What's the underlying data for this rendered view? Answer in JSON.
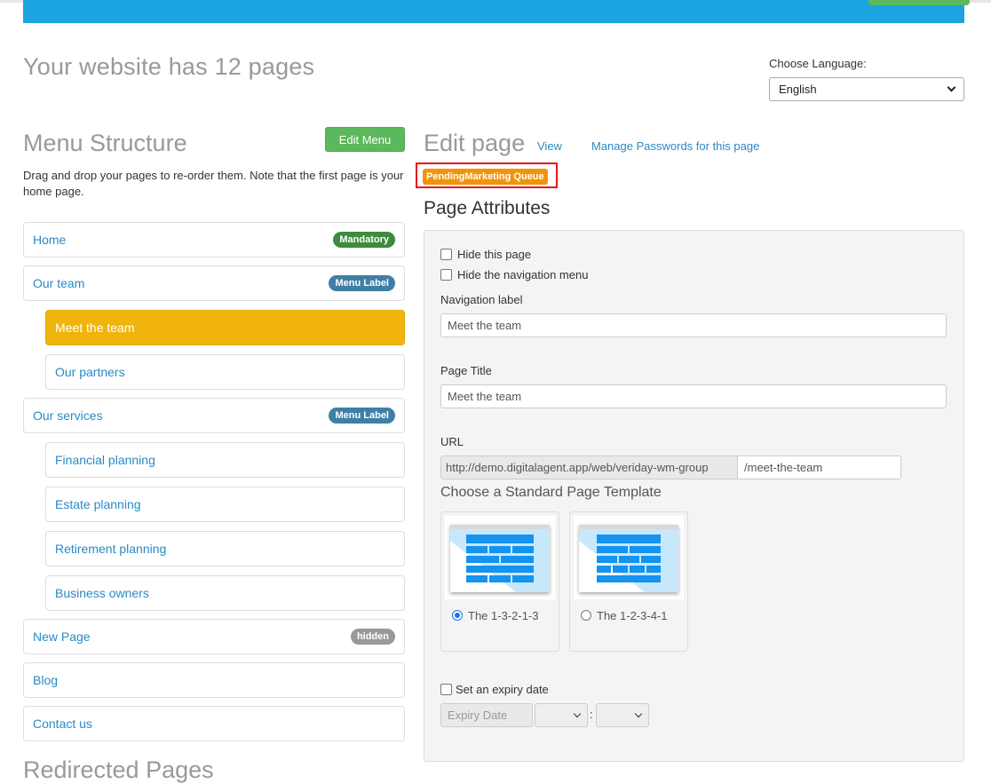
{
  "header": {
    "site_title": "Your website has 12 pages",
    "language_label": "Choose Language:",
    "language_value": "English"
  },
  "menu": {
    "title": "Menu Structure",
    "edit_button": "Edit Menu",
    "description": "Drag and drop your pages to re-order them. Note that the first page is your home page.",
    "items": [
      {
        "label": "Home",
        "badge": "Mandatory"
      },
      {
        "label": "Our team",
        "badge": "Menu Label"
      },
      {
        "label": "Meet the team",
        "badge": ""
      },
      {
        "label": "Our partners",
        "badge": ""
      },
      {
        "label": "Our services",
        "badge": "Menu Label"
      },
      {
        "label": "Financial planning",
        "badge": ""
      },
      {
        "label": "Estate planning",
        "badge": ""
      },
      {
        "label": "Retirement planning",
        "badge": ""
      },
      {
        "label": "Business owners",
        "badge": ""
      },
      {
        "label": "New Page",
        "badge": "hidden"
      },
      {
        "label": "Blog",
        "badge": ""
      },
      {
        "label": "Contact us",
        "badge": ""
      }
    ],
    "bottom_title": "Redirected Pages"
  },
  "edit": {
    "title": "Edit page",
    "view_link": "View",
    "passwords_link": "Manage Passwords for this page",
    "status_badge": "PendingMarketing Queue",
    "attributes_title": "Page Attributes",
    "hide_page_label": "Hide this page",
    "hide_nav_label": "Hide the navigation menu",
    "nav_label_label": "Navigation label",
    "nav_label_value": "Meet the team",
    "page_title_label": "Page Title",
    "page_title_value": "Meet the team",
    "url_label": "URL",
    "url_prefix": "http://demo.digitalagent.app/web/veriday-wm-group",
    "url_slug": "/meet-the-team",
    "template_title": "Choose a Standard Page Template",
    "templates": [
      {
        "name": "The 1-3-2-1-3",
        "selected": true
      },
      {
        "name": "The 1-2-3-4-1",
        "selected": false
      }
    ],
    "expiry_label": "Set an expiry date",
    "expiry_placeholder": "Expiry Date",
    "time_separator": ":"
  },
  "colors": {
    "accent_blue": "#1ba4e0",
    "success_green": "#5cb85c",
    "active_item": "#f0b40c",
    "status_orange": "#f0940c",
    "highlight_red": "#e8161b"
  }
}
